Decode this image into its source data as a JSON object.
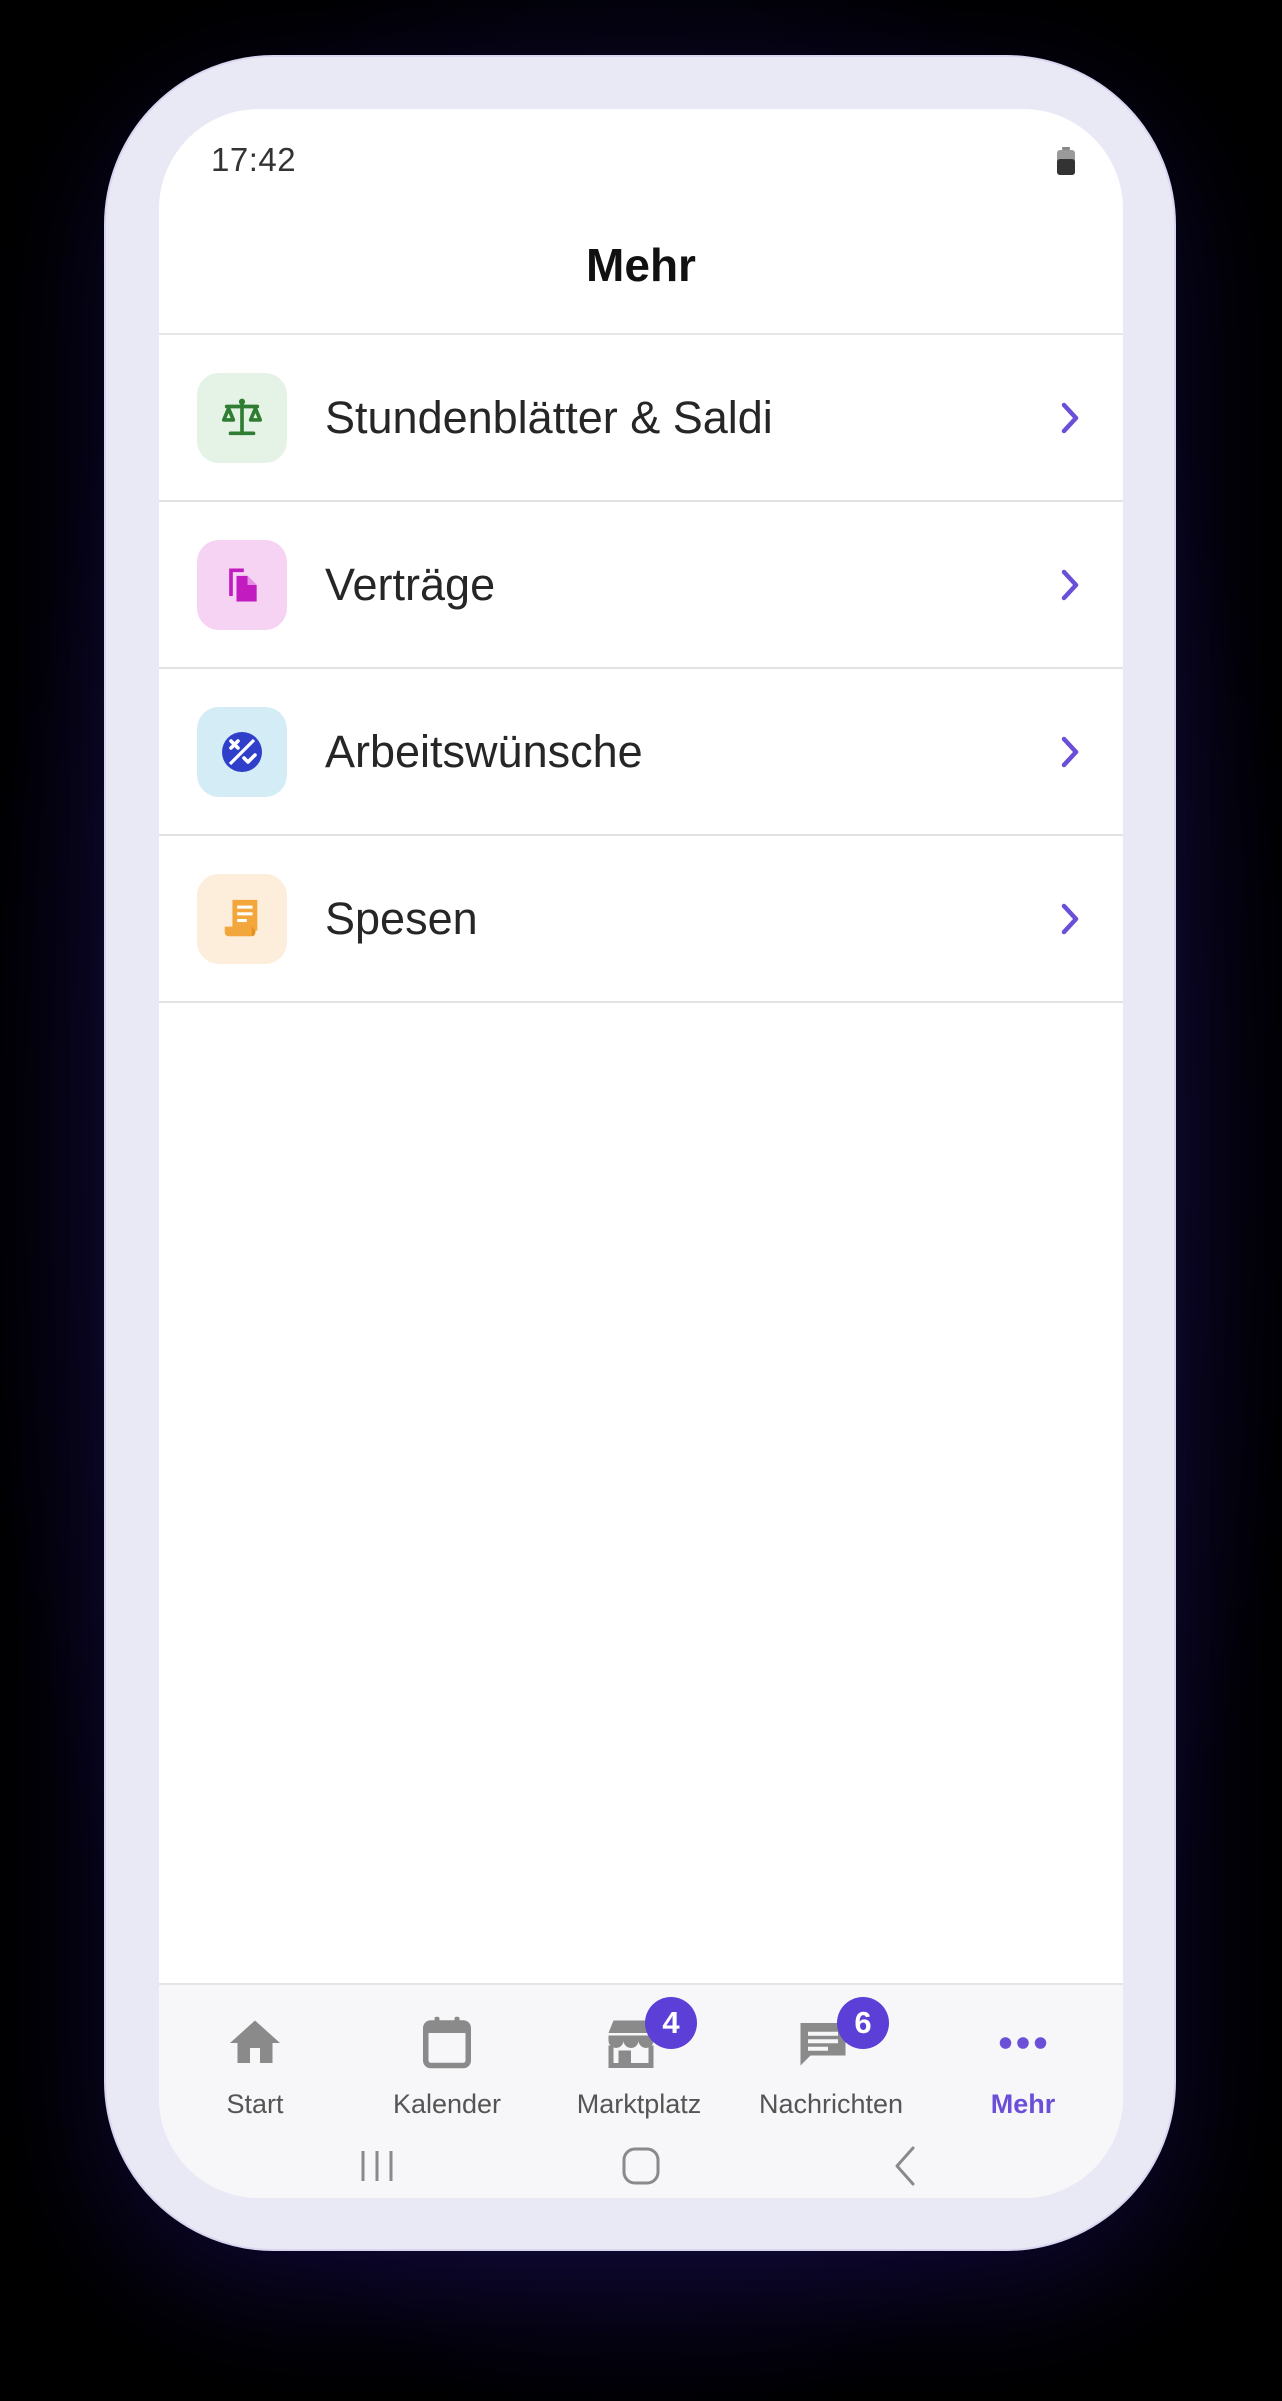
{
  "status": {
    "time": "17:42"
  },
  "header": {
    "title": "Mehr"
  },
  "menu": [
    {
      "label": "Stundenblätter & Saldi",
      "icon": "scale-icon",
      "bg": "#e4f3e6",
      "fg": "#2e7d32"
    },
    {
      "label": "Verträge",
      "icon": "documents-icon",
      "bg": "#f6d3f3",
      "fg": "#c21bbf"
    },
    {
      "label": "Arbeitswünsche",
      "icon": "preferences-icon",
      "bg": "#d4ecf6",
      "fg": "#2f3fc9"
    },
    {
      "label": "Spesen",
      "icon": "receipt-icon",
      "bg": "#fdeedb",
      "fg": "#f2a63b"
    }
  ],
  "tabs": [
    {
      "label": "Start",
      "icon": "home-icon"
    },
    {
      "label": "Kalender",
      "icon": "calendar-icon"
    },
    {
      "label": "Marktplatz",
      "icon": "store-icon",
      "badge": "4"
    },
    {
      "label": "Nachrichten",
      "icon": "message-icon",
      "badge": "6"
    },
    {
      "label": "Mehr",
      "icon": "more-dots-icon",
      "active": true
    }
  ],
  "colors": {
    "accent": "#6b4fd8",
    "badge": "#5b3fd6"
  }
}
